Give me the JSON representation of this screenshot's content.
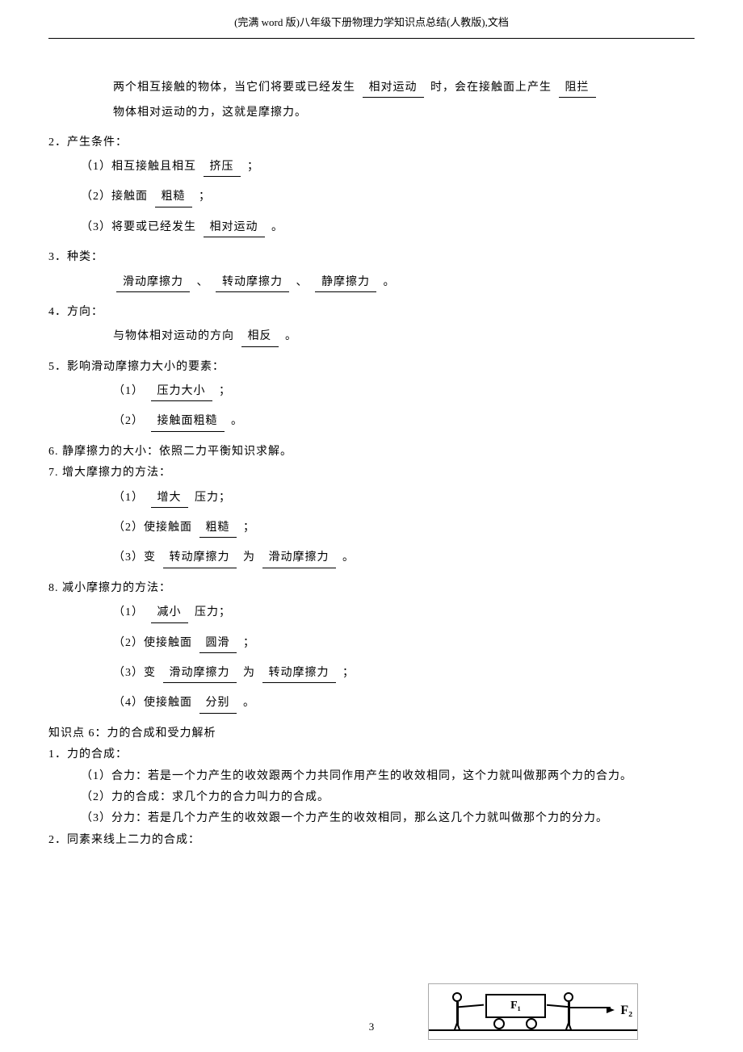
{
  "header": "(完满 word 版)八年级下册物理力学知识点总结(人教版),文档",
  "intro": {
    "l1a": "两个相互接触的物体，当它们将要或已经发生",
    "l1u": "相对运动",
    "l1b": "时，会在接触面上产生",
    "l1u2": "阻拦",
    "l2": "物体相对运动的力，这就是摩擦力。"
  },
  "s2": {
    "title": "2．产生条件：",
    "i1a": "（1）相互接触且相互",
    "i1u": "挤压",
    "i1b": "；",
    "i2a": "（2）接触面",
    "i2u": "粗糙",
    "i2b": "；",
    "i3a": "（3）将要或已经发生",
    "i3u": "相对运动",
    "i3b": "。"
  },
  "s3": {
    "title": "3．种类：",
    "u1": "滑动摩擦力",
    "s1": "、",
    "u2": "转动摩擦力",
    "s2": "、",
    "u3": "静摩擦力",
    "s3": "。"
  },
  "s4": {
    "title": "4．方向：",
    "a": "与物体相对运动的方向",
    "u": "相反",
    "b": "。"
  },
  "s5": {
    "title": "5．影响滑动摩擦力大小的要素：",
    "i1a": "（1）",
    "i1u": "压力大小",
    "i1b": "；",
    "i2a": "（2）",
    "i2u": "接触面粗糙",
    "i2b": "。"
  },
  "s6": "6.  静摩擦力的大小：依照二力平衡知识求解。",
  "s7": {
    "title": "7.  增大摩擦力的方法：",
    "i1a": "（1）",
    "i1u": "增大",
    "i1b": "压力；",
    "i2a": "（2）使接触面",
    "i2u": "粗糙",
    "i2b": "；",
    "i3a": "（3）变",
    "i3u1": "转动摩擦力",
    "i3m": "为",
    "i3u2": "滑动摩擦力",
    "i3b": "。"
  },
  "s8": {
    "title": "8.  减小摩擦力的方法：",
    "i1a": "（1）",
    "i1u": "减小",
    "i1b": "压力；",
    "i2a": "（2）使接触面",
    "i2u": "圆滑",
    "i2b": "；",
    "i3a": "（3）变",
    "i3u1": "滑动摩擦力",
    "i3m": "为",
    "i3u2": "转动摩擦力",
    "i3b": "；",
    "i4a": "（4）使接触面",
    "i4u": "分别",
    "i4b": "。"
  },
  "kp6": {
    "title": "知识点 6：力的合成和受力解析",
    "s1": "1．力的合成：",
    "c1": "（1）合力：若是一个力产生的收效跟两个力共同作用产生的收效相同，这个力就叫做那两个力的合力。",
    "c2": "（2）力的合成：求几个力的合力叫力的合成。",
    "c3": "（3）分力：若是几个力产生的收效跟一个力产生的收效相同，那么这几个力就叫做那个力的分力。",
    "s2": "2．同素来线上二力的合成："
  },
  "figure": {
    "f1": "F₁",
    "f2": "F₂"
  },
  "page_num": "3"
}
